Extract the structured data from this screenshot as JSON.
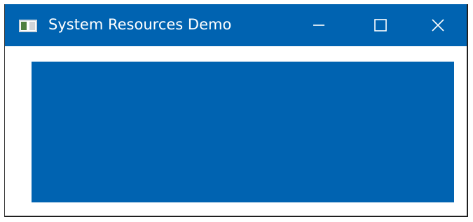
{
  "window": {
    "title": "System Resources Demo",
    "titlebar_color": "#0063b1",
    "content_color": "#0063b1",
    "icons": {
      "app": "window-app-icon",
      "minimize": "minimize-icon",
      "maximize": "maximize-icon",
      "close": "close-icon"
    }
  }
}
